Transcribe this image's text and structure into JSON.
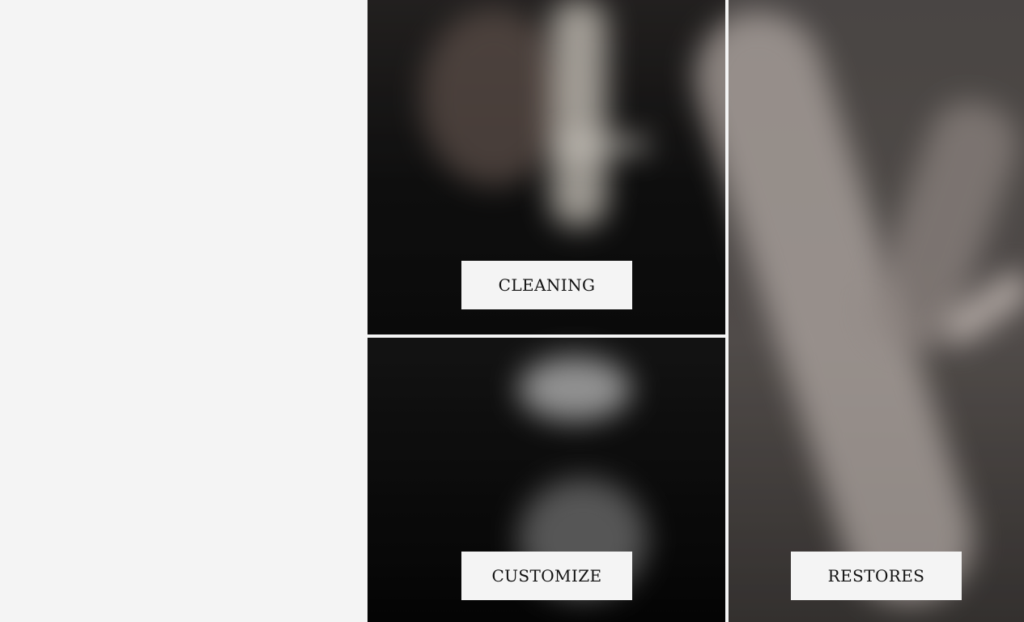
{
  "services": {
    "cleaning": {
      "label": "CLEANING"
    },
    "customize": {
      "label": "CUSTOMIZE"
    },
    "restores": {
      "label": "RESTORES"
    }
  }
}
